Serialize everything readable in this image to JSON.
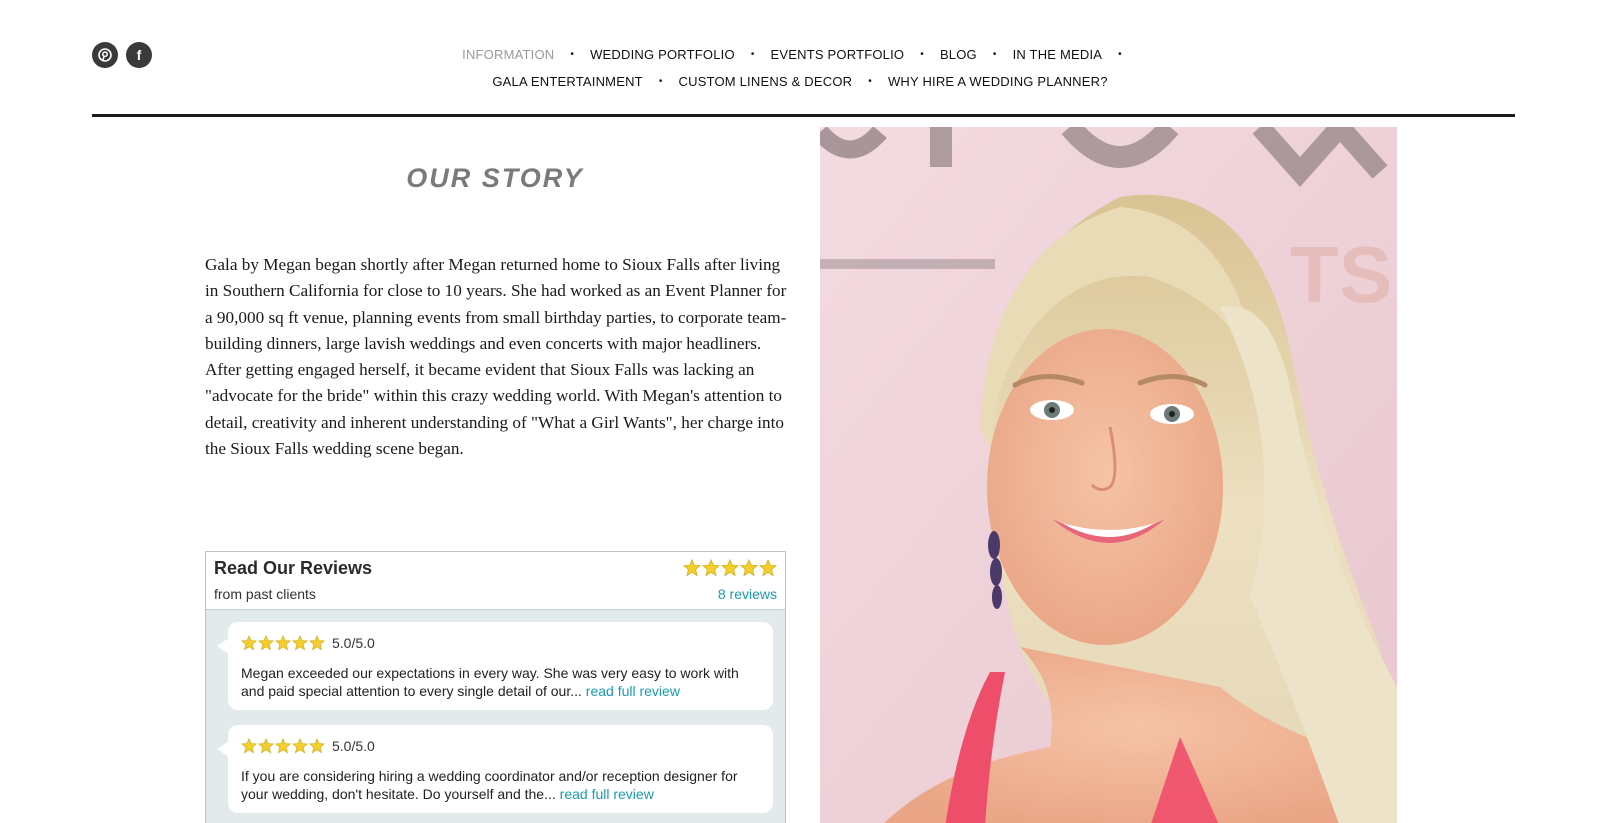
{
  "social": [
    {
      "icon": "pinterest-icon",
      "glyph": "p"
    },
    {
      "icon": "facebook-icon",
      "glyph": "f"
    }
  ],
  "nav": {
    "row1": [
      "INFORMATION",
      "WEDDING PORTFOLIO",
      "EVENTS PORTFOLIO",
      "BLOG",
      "IN THE MEDIA"
    ],
    "row2": [
      "GALA ENTERTAINMENT",
      "CUSTOM LINENS & DECOR",
      "WHY HIRE A WEDDING PLANNER?"
    ],
    "active": "INFORMATION",
    "separator": "•"
  },
  "story": {
    "title": "OUR STORY",
    "body": "Gala by Megan began shortly after Megan returned home to Sioux Falls after living in Southern California for close to 10 years. She had worked as an Event Planner for a 90,000 sq ft venue, planning events from small birthday parties, to corporate team-building dinners, large lavish weddings and even concerts with major headliners. After getting engaged herself, it became evident that Sioux Falls was lacking an \"advocate for the bride\" within this crazy wedding world. With Megan's attention to detail, creativity and inherent understanding of \"What a Girl Wants\", her charge into the Sioux Falls wedding scene began."
  },
  "reviews": {
    "title": "Read Our Reviews",
    "subtitle": "from past clients",
    "count_label": "8 reviews",
    "overall_stars": 5,
    "items": [
      {
        "score": "5.0/5.0",
        "stars": 5,
        "text": "Megan exceeded our expectations in every way. She was very easy to work with and paid special attention to every single detail of our...",
        "link": "read full review"
      },
      {
        "score": "5.0/5.0",
        "stars": 5,
        "text": "If you are considering hiring a wedding coordinator and/or reception designer for your wedding, don't hesitate. Do yourself and the...",
        "link": "read full review"
      }
    ]
  },
  "colors": {
    "star": "#f2cf2a",
    "link": "#1a9bb0",
    "photo_bg": "#efd3da",
    "hair": "#e6d6ad",
    "skin": "#f1b79a",
    "tank": "#ef4e6a"
  }
}
